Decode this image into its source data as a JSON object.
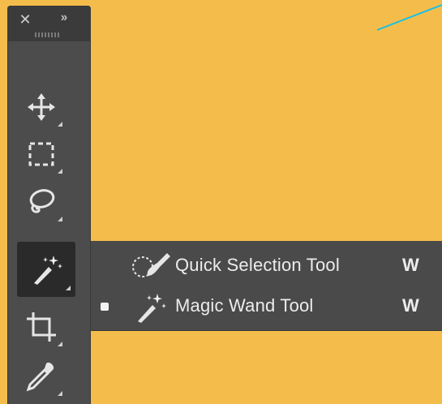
{
  "colors": {
    "background": "#f4bd4b",
    "panel": "#4c4c4c",
    "panel_header": "#3b3b3b",
    "selected_tool": "#2a2a2a",
    "flyout": "#4a4a4a",
    "text": "#ececec",
    "accent_line": "#19c0e6"
  },
  "toolbar": {
    "close_icon": "close-icon",
    "collapse_icon": "double-chevron-icon",
    "tools": [
      {
        "name": "move",
        "icon": "move-arrows-icon"
      },
      {
        "name": "marquee",
        "icon": "rectangular-marquee-icon"
      },
      {
        "name": "lasso",
        "icon": "lasso-icon"
      },
      {
        "name": "magic-wand",
        "icon": "magic-wand-icon",
        "selected": true
      },
      {
        "name": "crop",
        "icon": "crop-icon"
      },
      {
        "name": "eyedropper",
        "icon": "eyedropper-icon"
      }
    ]
  },
  "flyout": {
    "items": [
      {
        "label": "Quick Selection Tool",
        "shortcut": "W",
        "icon": "quick-selection-brush-icon",
        "active": false
      },
      {
        "label": "Magic Wand Tool",
        "shortcut": "W",
        "icon": "magic-wand-icon",
        "active": true
      }
    ]
  }
}
